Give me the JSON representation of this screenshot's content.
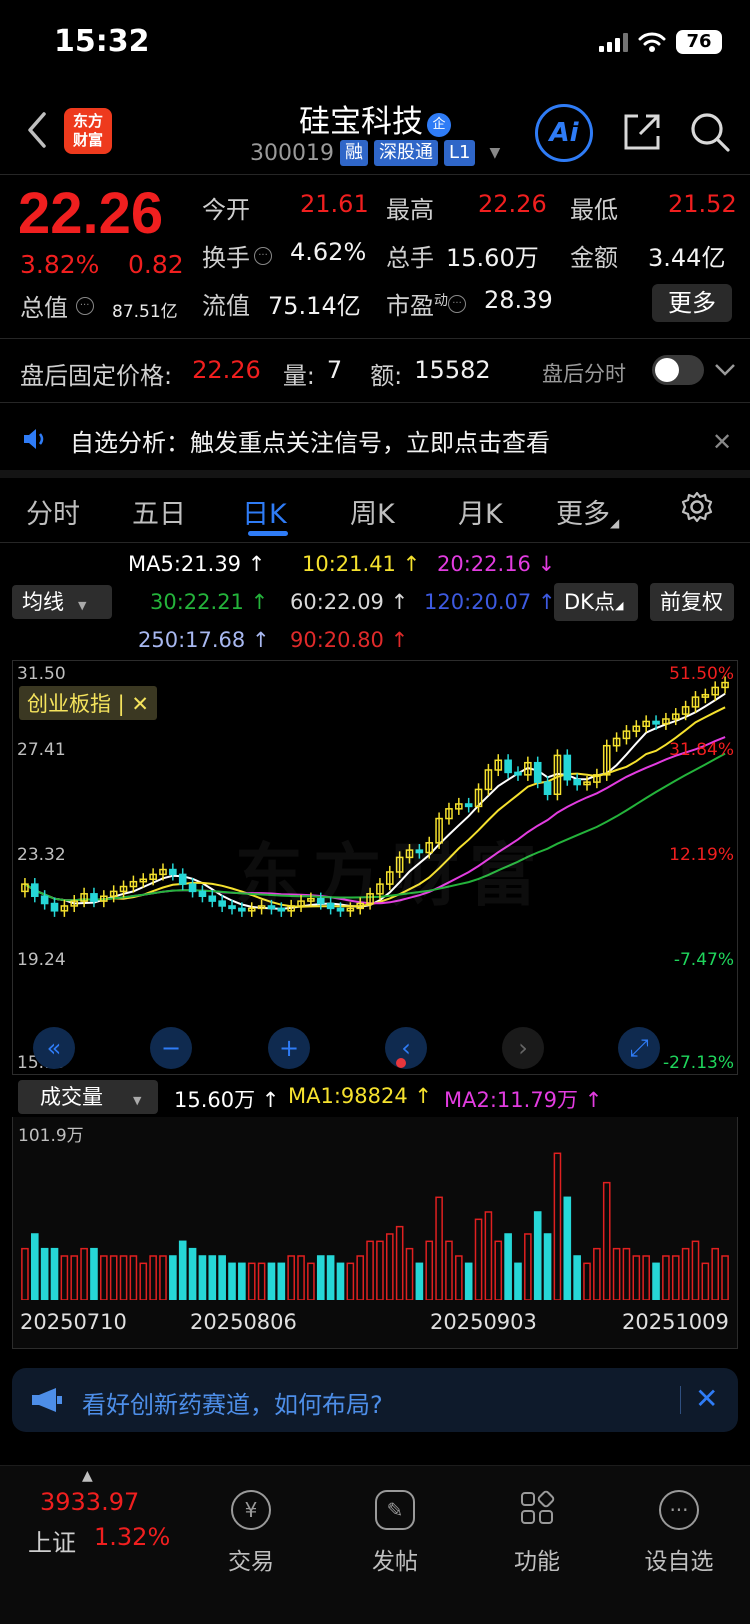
{
  "status": {
    "time": "15:32",
    "battery": "76"
  },
  "header": {
    "logo_line1": "东方",
    "logo_line2": "财富",
    "stock_name": "硅宝科技",
    "name_badge": "企",
    "code": "300019",
    "tags": [
      "融",
      "深股通",
      "L1"
    ],
    "ai_label": "Ai"
  },
  "quote": {
    "price": "22.26",
    "pct": "3.82%",
    "change": "0.82",
    "open_label": "今开",
    "open": "21.61",
    "high_label": "最高",
    "high": "22.26",
    "low_label": "最低",
    "low": "21.52",
    "turnover_label": "换手",
    "turnover": "4.62%",
    "volume_label": "总手",
    "volume": "15.60万",
    "amount_label": "金额",
    "amount": "3.44亿",
    "mcap_label": "总值",
    "mcap": "87.51亿",
    "float_label": "流值",
    "float_cap": "75.14亿",
    "pe_label": "市盈",
    "pe_sup": "动",
    "pe": "28.39",
    "more_label": "更多",
    "colors": {
      "up": "#f01f1f",
      "down": "#1fd65c"
    }
  },
  "after_hours": {
    "label": "盘后固定价格:",
    "price": "22.26",
    "qty_label": "量:",
    "qty": "7",
    "amt_label": "额:",
    "amt": "15582",
    "toggle_label": "盘后分时"
  },
  "alert": {
    "text": "自选分析：触发重点关注信号，立即点击查看"
  },
  "tabs": [
    "分时",
    "五日",
    "日K",
    "周K",
    "月K",
    "更多"
  ],
  "active_tab": "日K",
  "ma_legend": {
    "ma5": "MA5:21.39",
    "ma10": "10:21.41",
    "ma20": "20:22.16",
    "ma30": "30:22.21",
    "ma60": "60:22.09",
    "ma120": "120:20.07",
    "ma250": "250:17.68",
    "ma90": "90:20.80",
    "indicator_select": "均线",
    "dk_button": "DK点",
    "adjust_button": "前复权",
    "colors": {
      "ma5": "#ffffff",
      "ma10": "#f5e12e",
      "ma20": "#e23ce0",
      "ma30": "#24b33b",
      "ma60": "#d9d9d9",
      "ma120": "#3d4fd6",
      "ma250": "#a8b8f0",
      "ma90": "#d41f1f"
    }
  },
  "kchart": {
    "left_axis": [
      "31.50",
      "27.41",
      "23.32",
      "19.24",
      "15.15"
    ],
    "right_axis": [
      "51.50%",
      "31.84%",
      "12.19%",
      "-7.47%",
      "-27.13%"
    ],
    "index_chip": "创业板指 | ✕",
    "watermark": "东方财富"
  },
  "volume": {
    "select": "成交量",
    "value": "15.60万",
    "ma1": "MA1:98824",
    "ma2": "MA2:11.79万",
    "max_label": "101.9万",
    "dates": [
      "20250710",
      "20250806",
      "20250903",
      "20251009"
    ]
  },
  "chart_data": [
    {
      "type": "candlestick",
      "title": "",
      "ylim": [
        15.15,
        31.5
      ],
      "closes": [
        22.6,
        22.1,
        21.8,
        21.5,
        21.7,
        21.9,
        22.2,
        21.9,
        22.1,
        22.3,
        22.5,
        22.7,
        22.8,
        23.0,
        23.2,
        23.0,
        22.6,
        22.3,
        22.1,
        21.9,
        21.7,
        21.6,
        21.5,
        21.6,
        21.7,
        21.6,
        21.5,
        21.7,
        21.9,
        22.0,
        21.8,
        21.6,
        21.5,
        21.6,
        21.8,
        22.2,
        22.6,
        23.1,
        23.7,
        24.0,
        23.9,
        24.3,
        25.3,
        25.7,
        25.9,
        25.8,
        26.5,
        27.3,
        27.7,
        27.2,
        27.1,
        27.6,
        26.8,
        26.3,
        27.9,
        26.9,
        26.7,
        26.8,
        27.1,
        28.3,
        28.6,
        28.9,
        29.1,
        29.3,
        29.2,
        29.4,
        29.6,
        29.9,
        30.3,
        30.4,
        30.7,
        30.9
      ],
      "volume_ylim": [
        0,
        1019000
      ],
      "volume_max_label": "101.9万"
    }
  ],
  "ad": {
    "text": "看好创新药赛道，如何布局?"
  },
  "bottom_nav": {
    "index_value": "3933.97",
    "index_name": "上证",
    "index_pct": "1.32%",
    "items": [
      {
        "label": "交易",
        "icon": "yen-exchange-icon"
      },
      {
        "label": "发帖",
        "icon": "edit-post-icon"
      },
      {
        "label": "功能",
        "icon": "grid-apps-icon"
      },
      {
        "label": "设自选",
        "icon": "more-dots-icon"
      }
    ]
  }
}
